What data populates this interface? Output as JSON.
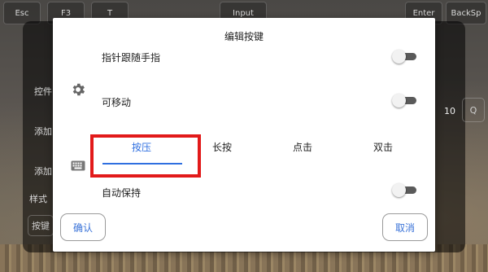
{
  "background": {
    "keys": [
      "Esc",
      "F3",
      "T",
      "Input",
      "Enter",
      "BackSp"
    ],
    "side_labels": [
      "控件",
      "添加",
      "添加",
      "样式",
      "按键"
    ],
    "right_number": "10",
    "right_key": "Q"
  },
  "dialog": {
    "title": "编辑按键",
    "rows": {
      "follow_finger": "指针跟随手指",
      "movable": "可移动",
      "auto_hold": "自动保持"
    },
    "icons": {
      "settings": "gear-icon",
      "keyboard": "keyboard-icon"
    },
    "tabs": [
      {
        "label": "按压",
        "active": true
      },
      {
        "label": "长按",
        "active": false
      },
      {
        "label": "点击",
        "active": false
      },
      {
        "label": "双击",
        "active": false
      }
    ],
    "toggles": {
      "follow_finger": false,
      "movable": false,
      "auto_hold": false
    },
    "confirm_label": "确认",
    "cancel_label": "取消"
  },
  "colors": {
    "accent": "#2f6fe0",
    "highlight": "#e21a1a",
    "toggle_track": "#5a5a5a"
  }
}
